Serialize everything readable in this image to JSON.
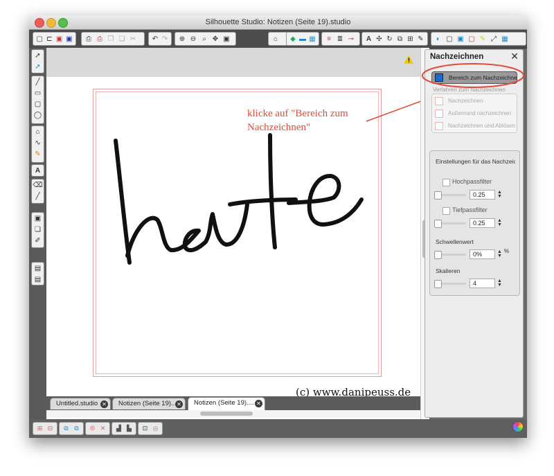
{
  "window": {
    "title": "Silhouette Studio: Notizen (Seite 19).studio",
    "traffic_colors": [
      "#ec5b55",
      "#f2b83a",
      "#54c04a"
    ]
  },
  "toolbar": {
    "icons": [
      "new-document-icon",
      "open-icon",
      "save-icon",
      "save-as-icon",
      "print-icon",
      "print-cut-icon",
      "copy-icon",
      "paste-icon",
      "cut-icon",
      "undo-icon",
      "redo-icon",
      "zoom-in-icon",
      "zoom-out-icon",
      "zoom-select-icon",
      "pan-icon",
      "fit-page-icon",
      "library-icon",
      "fill-color-icon",
      "line-color-icon",
      "line-style-icon",
      "gradient-icon",
      "text-style-icon",
      "text-icon",
      "transform-icon",
      "replicate-icon",
      "modify-icon",
      "offset-icon",
      "trace-icon",
      "store-icon",
      "page-setup-icon",
      "cut-settings-icon",
      "register-icon",
      "pen-icon",
      "fullscreen-icon",
      "grid-icon"
    ]
  },
  "left_tools": {
    "icons": [
      "select-icon",
      "point-edit-icon",
      "line-icon",
      "rectangle-icon",
      "rounded-rectangle-icon",
      "ellipse-icon",
      "polygon-icon",
      "curve-icon",
      "freehand-icon",
      "text-tool-icon",
      "eraser-icon",
      "knife-icon",
      "sketch-icon",
      "layer-icon",
      "library-tool-icon",
      "panel-icon"
    ]
  },
  "canvas": {
    "handwriting_text": "heute",
    "annotation": "klicke auf \"Bereich zum Nachzeichnen\"",
    "copyright": "(c) www.danipeuss.de",
    "warning_icon": "warning-icon",
    "annotation_color": "#e34a3a"
  },
  "tabs": [
    {
      "label": "Untitled.studio",
      "active": false
    },
    {
      "label": "Notizen (Seite 19)....",
      "active": false
    },
    {
      "label": "Notizen (Seite 19)....",
      "active": true
    }
  ],
  "panel": {
    "title": "Nachzeichnen",
    "select_area_button": "Bereich zum Nachzeichnen",
    "method_label": "Verfahren zum Nachzeichnen",
    "methods": [
      {
        "label": "Nachzeichnen",
        "icon": "trace-method-icon"
      },
      {
        "label": "Außenrand nachzeichnen",
        "icon": "trace-outer-edge-icon"
      },
      {
        "label": "Nachzeichnen und Ablösen",
        "icon": "trace-and-detach-icon"
      }
    ],
    "settings_label": "Einstellungen für das Nachzeichnen",
    "highpass": {
      "label": "Hochpassfilter",
      "value": "0.25",
      "checked": false
    },
    "lowpass": {
      "label": "Tiefpassfilter",
      "value": "0.25",
      "checked": false
    },
    "threshold": {
      "label": "Schwellenwert",
      "value": "0%",
      "unit": "%"
    },
    "scale": {
      "label": "Skalieren",
      "value": "4"
    }
  },
  "bottom_bar": {
    "icons": [
      "group-icon",
      "ungroup-icon",
      "compound-path-icon",
      "release-compound-icon",
      "weld-icon",
      "delete-icon",
      "bring-front-icon",
      "send-back-icon",
      "lock-icon",
      "target-icon"
    ],
    "corner_icon": "color-wheel-icon"
  }
}
